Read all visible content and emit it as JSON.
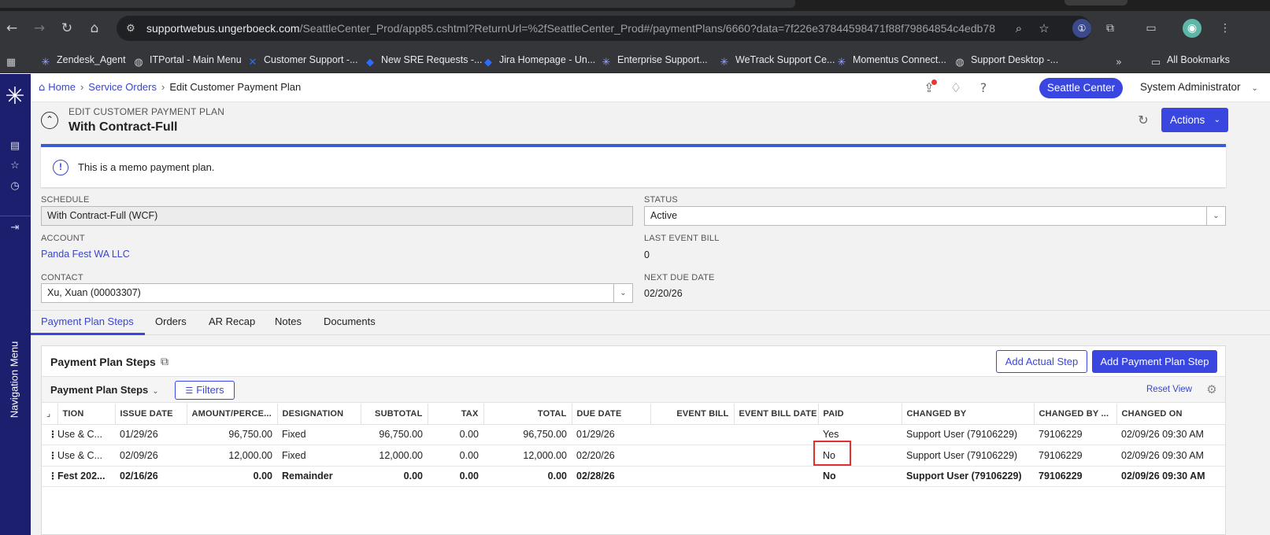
{
  "browser": {
    "url_host": "supportwebus.ungerboeck.com",
    "url_path": "/SeattleCenter_Prod/app85.cshtml?ReturnUrl=%2fSeattleCenter_Prod#/paymentPlans/6660?data=7f226e37844598471f88f79864854c4edb78",
    "bookmarks": [
      {
        "label": "Zendesk_Agent",
        "icon": "asterisk-icon",
        "color": "#9da6ff"
      },
      {
        "label": "ITPortal - Main Menu",
        "icon": "globe-icon",
        "color": "#c8c8c8"
      },
      {
        "label": "Customer Support -...",
        "icon": "confluence-icon",
        "color": "#2d6bff"
      },
      {
        "label": "New SRE Requests -...",
        "icon": "jira-icon",
        "color": "#2d6bff"
      },
      {
        "label": "Jira Homepage - Un...",
        "icon": "jira-icon",
        "color": "#2d6bff"
      },
      {
        "label": "Enterprise Support...",
        "icon": "asterisk-icon",
        "color": "#9da6ff"
      },
      {
        "label": "WeTrack Support Ce...",
        "icon": "asterisk-icon",
        "color": "#9da6ff"
      },
      {
        "label": "Momentus Connect...",
        "icon": "asterisk-icon",
        "color": "#9da6ff"
      },
      {
        "label": "Support Desktop -...",
        "icon": "globe-icon",
        "color": "#c8c8c8"
      }
    ],
    "all_bookmarks": "All Bookmarks"
  },
  "rail": {
    "nav_label": "Navigation Menu"
  },
  "header": {
    "breadcrumbs": [
      "Home",
      "Service Orders",
      "Edit Customer Payment Plan"
    ],
    "venue": "Seattle Center",
    "user": "System Administrator"
  },
  "page": {
    "eyebrow": "EDIT CUSTOMER PAYMENT PLAN",
    "title": "With Contract-Full",
    "actions_label": "Actions",
    "memo": "This is a memo payment plan."
  },
  "form": {
    "schedule_label": "SCHEDULE",
    "schedule_value": "With Contract-Full (WCF)",
    "status_label": "STATUS",
    "status_value": "Active",
    "account_label": "ACCOUNT",
    "account_value": "Panda Fest WA LLC",
    "last_event_bill_label": "LAST EVENT BILL",
    "last_event_bill_value": "0",
    "contact_label": "CONTACT",
    "contact_value": "Xu, Xuan (00003307)",
    "next_due_date_label": "NEXT DUE DATE",
    "next_due_date_value": "02/20/26"
  },
  "tabs": [
    "Payment Plan Steps",
    "Orders",
    "AR Recap",
    "Notes",
    "Documents"
  ],
  "grid": {
    "title": "Payment Plan Steps",
    "add_actual_label": "Add Actual Step",
    "add_step_label": "Add Payment Plan Step",
    "view_label": "Payment Plan Steps",
    "filters_label": "Filters",
    "reset_view_label": "Reset View",
    "columns": [
      "TION",
      "ISSUE DATE",
      "AMOUNT/PERCE...",
      "DESIGNATION",
      "SUBTOTAL",
      "TAX",
      "TOTAL",
      "DUE DATE",
      "EVENT BILL",
      "EVENT BILL DATE",
      "PAID",
      "CHANGED BY",
      "CHANGED BY ...",
      "CHANGED ON"
    ],
    "rows": [
      {
        "desc": "Use & C...",
        "issue": "01/29/26",
        "amount": "96,750.00",
        "designation": "Fixed",
        "subtotal": "96,750.00",
        "tax": "0.00",
        "total": "96,750.00",
        "due": "01/29/26",
        "event_bill": "",
        "event_bill_date": "",
        "paid": "Yes",
        "changed_by": "Support User (79106229)",
        "changed_by_id": "79106229",
        "changed_on": "02/09/26 09:30 AM"
      },
      {
        "desc": "Use & C...",
        "issue": "02/09/26",
        "amount": "12,000.00",
        "designation": "Fixed",
        "subtotal": "12,000.00",
        "tax": "0.00",
        "total": "12,000.00",
        "due": "02/20/26",
        "event_bill": "",
        "event_bill_date": "",
        "paid": "No",
        "changed_by": "Support User (79106229)",
        "changed_by_id": "79106229",
        "changed_on": "02/09/26 09:30 AM"
      },
      {
        "desc": "Fest 202...",
        "issue": "02/16/26",
        "amount": "0.00",
        "designation": "Remainder",
        "subtotal": "0.00",
        "tax": "0.00",
        "total": "0.00",
        "due": "02/28/26",
        "event_bill": "",
        "event_bill_date": "",
        "paid": "No",
        "changed_by": "Support User (79106229)",
        "changed_by_id": "79106229",
        "changed_on": "02/09/26 09:30 AM"
      }
    ]
  },
  "colors": {
    "brand_navy": "#1b1f6e",
    "accent": "#3a46e0",
    "highlight": "#e03030"
  }
}
